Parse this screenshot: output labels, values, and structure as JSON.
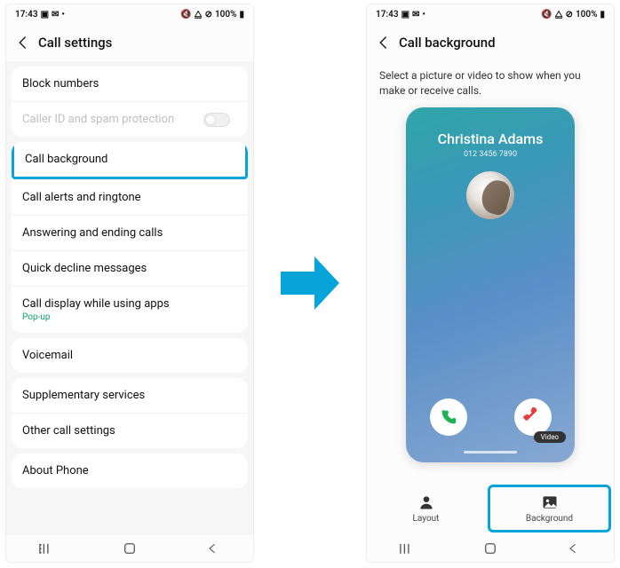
{
  "status": {
    "time": "17:43",
    "battery": "100%"
  },
  "left": {
    "title": "Call settings",
    "items": [
      {
        "label": "Block numbers"
      },
      {
        "label": "Caller ID and spam protection",
        "disabled": true,
        "toggle": true
      },
      {
        "label": "Call background",
        "highlight": true
      },
      {
        "label": "Call alerts and ringtone"
      },
      {
        "label": "Answering and ending calls"
      },
      {
        "label": "Quick decline messages"
      },
      {
        "label": "Call display while using apps",
        "sub": "Pop-up"
      },
      {
        "label": "Voicemail"
      },
      {
        "label": "Supplementary services"
      },
      {
        "label": "Other call settings"
      },
      {
        "label": "About Phone"
      }
    ]
  },
  "right": {
    "title": "Call background",
    "description": "Select a picture or video to show when you make or receive calls.",
    "caller_name": "Christina Adams",
    "caller_number": "012 3456 7890",
    "video_chip": "Video",
    "tabs": {
      "layout": "Layout",
      "background": "Background"
    }
  }
}
